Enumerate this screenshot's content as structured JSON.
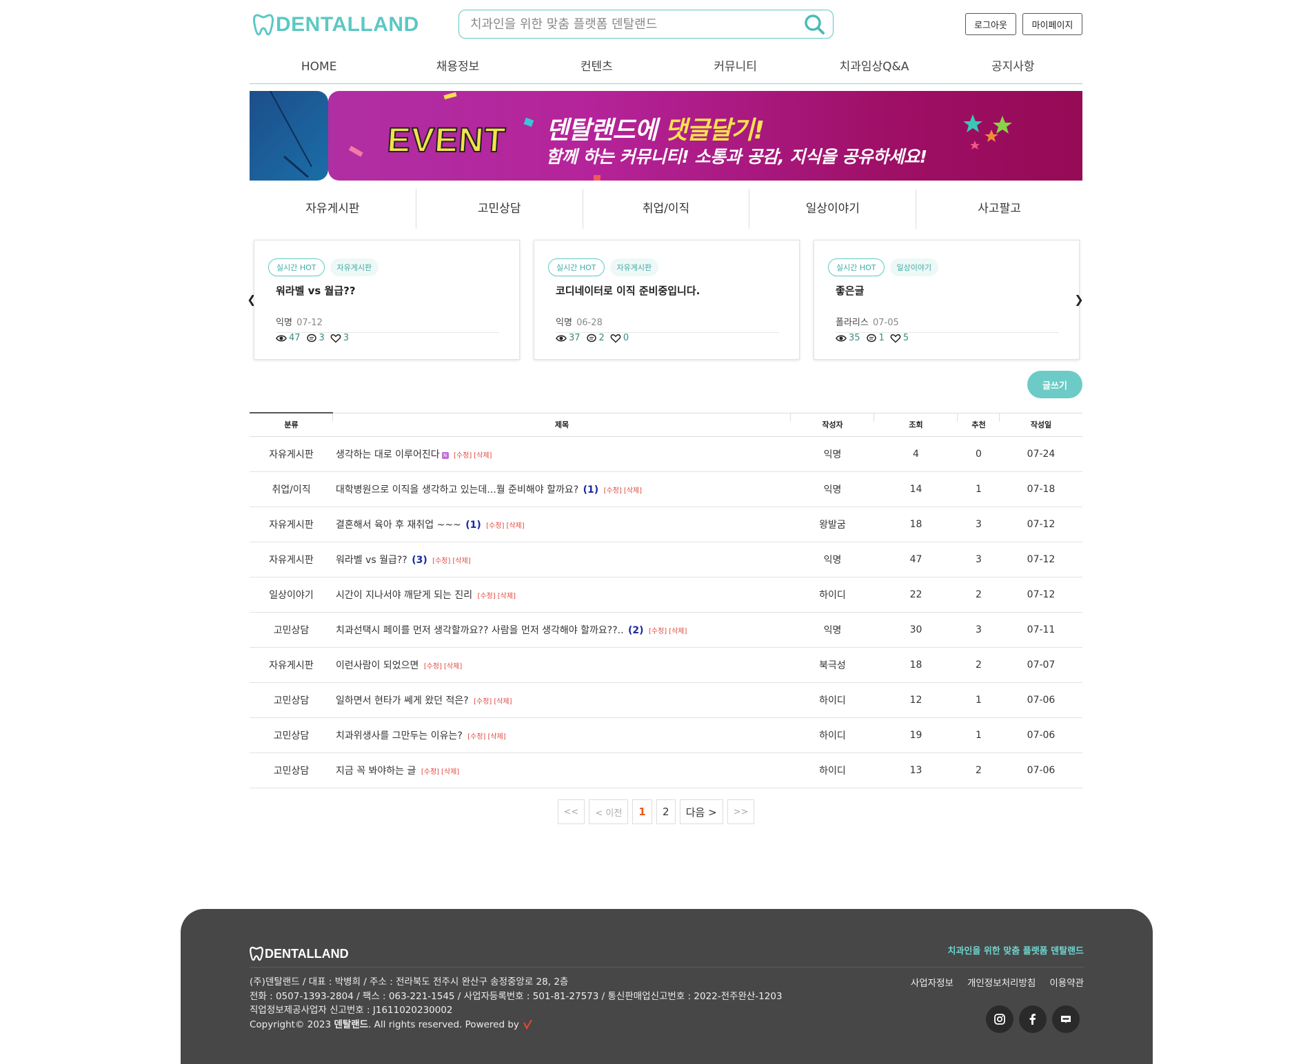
{
  "header": {
    "logo_text": "DENTALLAND",
    "search_placeholder": "치과인을 위한 맞춤 플랫폼 덴탈랜드",
    "logout_label": "로그아웃",
    "mypage_label": "마이페이지"
  },
  "nav": [
    "HOME",
    "채용정보",
    "컨텐츠",
    "커뮤니티",
    "치과임상Q&A",
    "공지사항"
  ],
  "banner": {
    "badge": "EVENT",
    "title_a": "덴탈랜드에 ",
    "title_b": "댓글달기!",
    "subtitle": "함께 하는 커뮤니티! 소통과 공감, 지식을 공유하세요!"
  },
  "tabs": [
    "자유게시판",
    "고민상담",
    "취업/이직",
    "일상이야기",
    "사고팔고"
  ],
  "hot_cards": [
    {
      "badge": "실시간 HOT",
      "category": "자유게시판",
      "title": "워라벨 vs 월급??",
      "author": "익명",
      "date": "07-12",
      "views": "47",
      "comments": "3",
      "likes": "3"
    },
    {
      "badge": "실시간 HOT",
      "category": "자유게시판",
      "title": "코디네이터로 이직 준비중입니다.",
      "author": "익명",
      "date": "06-28",
      "views": "37",
      "comments": "2",
      "likes": "0"
    },
    {
      "badge": "실시간 HOT",
      "category": "일상이야기",
      "title": "좋은글",
      "author": "폴라리스",
      "date": "07-05",
      "views": "35",
      "comments": "1",
      "likes": "5"
    }
  ],
  "write_label": "글쓰기",
  "table": {
    "headers": [
      "분류",
      "제목",
      "작성자",
      "조회",
      "추천",
      "작성일"
    ],
    "edit_label": "[수정]",
    "delete_label": "[삭제]",
    "rows": [
      {
        "category": "자유게시판",
        "title": "생각하는 대로 이루어진다",
        "comments": "",
        "is_new": true,
        "author": "익명",
        "views": "4",
        "likes": "0",
        "date": "07-24"
      },
      {
        "category": "취업/이직",
        "title": "대학병원으로 이직을 생각하고 있는데...뭘 준비해야 할까요?",
        "comments": "(1)",
        "is_new": false,
        "author": "익명",
        "views": "14",
        "likes": "1",
        "date": "07-18"
      },
      {
        "category": "자유게시판",
        "title": "결혼해서 육아 후 재취업 ~~~",
        "comments": "(1)",
        "is_new": false,
        "author": "왕발굼",
        "views": "18",
        "likes": "3",
        "date": "07-12"
      },
      {
        "category": "자유게시판",
        "title": "워라벨 vs 월급??",
        "comments": "(3)",
        "is_new": false,
        "author": "익명",
        "views": "47",
        "likes": "3",
        "date": "07-12"
      },
      {
        "category": "일상이야기",
        "title": "시간이 지나서야 깨닫게 되는 진리",
        "comments": "",
        "is_new": false,
        "author": "하이디",
        "views": "22",
        "likes": "2",
        "date": "07-12"
      },
      {
        "category": "고민상담",
        "title": "치과선택시 페이를 먼저 생각할까요?? 사람을 먼저 생각해야 할까요??..",
        "comments": "(2)",
        "is_new": false,
        "author": "익명",
        "views": "30",
        "likes": "3",
        "date": "07-11"
      },
      {
        "category": "자유게시판",
        "title": "이런사람이 되었으면",
        "comments": "",
        "is_new": false,
        "author": "북극성",
        "views": "18",
        "likes": "2",
        "date": "07-07"
      },
      {
        "category": "고민상담",
        "title": "일하면서 현타가 쎄게 왔던 적은?",
        "comments": "",
        "is_new": false,
        "author": "하이디",
        "views": "12",
        "likes": "1",
        "date": "07-06"
      },
      {
        "category": "고민상담",
        "title": "치과위생사를 그만두는 이유는?",
        "comments": "",
        "is_new": false,
        "author": "하이디",
        "views": "19",
        "likes": "1",
        "date": "07-06"
      },
      {
        "category": "고민상담",
        "title": "지금 꼭 봐야하는 글",
        "comments": "",
        "is_new": false,
        "author": "하이디",
        "views": "13",
        "likes": "2",
        "date": "07-06"
      }
    ]
  },
  "pagination": {
    "first": "<<",
    "prev": "< 이전",
    "pages": [
      "1",
      "2"
    ],
    "current": "1",
    "next": "다음 >",
    "last": ">>"
  },
  "footer": {
    "logo_text": "DENTALLAND",
    "tagline": "치과인을 위한 맞춤 플랫폼 덴탈랜드",
    "info_line1": "(주)덴탈랜드  /  대표 : 박병희  /  주소 : 전라북도 전주시 완산구 송정중앙로 28, 2층",
    "info_line2": "전화 : 0507-1393-2804  /  팩스 : 063-221-1545  /  사업자등록번호 : 501-81-27573  /  통신판매업신고번호 : 2022-전주완산-1203",
    "info_line3": "직업정보제공사업자 신고번호 : J1611020230002",
    "copyright_a": "Copyright© 2023 ",
    "copyright_b": "덴탈랜드",
    "copyright_c": ". All rights reserved. Powered by",
    "links": [
      "사업자정보",
      "개인정보처리방침",
      "이용약관"
    ],
    "sns": [
      "instagram-icon",
      "facebook-icon",
      "blog-icon"
    ]
  },
  "colors": {
    "accent": "#5cc8c4",
    "banner_pink": "#b02fa3",
    "footer_bg": "#474747"
  }
}
